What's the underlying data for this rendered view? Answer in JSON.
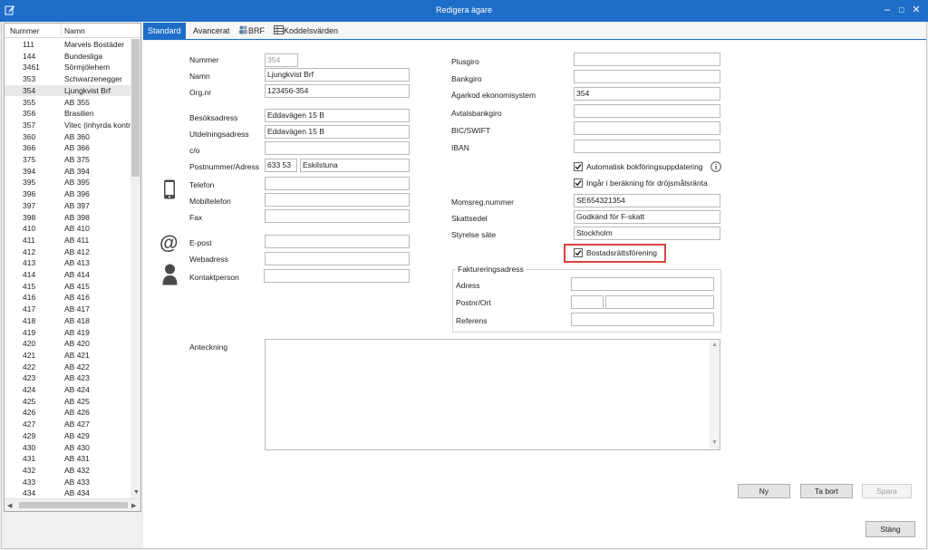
{
  "window": {
    "title": "Redigera ägare"
  },
  "list": {
    "headers": [
      "Nummer",
      "Namn"
    ],
    "rows": [
      {
        "num": "111",
        "name": "Marvels Bostäder"
      },
      {
        "num": "144",
        "name": "Bundesliga"
      },
      {
        "num": "3461",
        "name": "Sörmjölehem"
      },
      {
        "num": "353",
        "name": "Schwarzenegger"
      },
      {
        "num": "354",
        "name": "Ljungkvist Brf"
      },
      {
        "num": "355",
        "name": "AB 355"
      },
      {
        "num": "356",
        "name": "Brasilien"
      },
      {
        "num": "357",
        "name": "Vitec (inhyrda kontra"
      },
      {
        "num": "360",
        "name": "AB 360"
      },
      {
        "num": "366",
        "name": "AB 366"
      },
      {
        "num": "375",
        "name": "AB 375"
      },
      {
        "num": "394",
        "name": "AB 394"
      },
      {
        "num": "395",
        "name": "AB 395"
      },
      {
        "num": "396",
        "name": "AB 396"
      },
      {
        "num": "397",
        "name": "AB 397"
      },
      {
        "num": "398",
        "name": "AB 398"
      },
      {
        "num": "410",
        "name": "AB 410"
      },
      {
        "num": "411",
        "name": "AB 411"
      },
      {
        "num": "412",
        "name": "AB 412"
      },
      {
        "num": "413",
        "name": "AB 413"
      },
      {
        "num": "414",
        "name": "AB 414"
      },
      {
        "num": "415",
        "name": "AB 415"
      },
      {
        "num": "416",
        "name": "AB 416"
      },
      {
        "num": "417",
        "name": "AB 417"
      },
      {
        "num": "418",
        "name": "AB 418"
      },
      {
        "num": "419",
        "name": "AB 419"
      },
      {
        "num": "420",
        "name": "AB 420"
      },
      {
        "num": "421",
        "name": "AB 421"
      },
      {
        "num": "422",
        "name": "AB 422"
      },
      {
        "num": "423",
        "name": "AB 423"
      },
      {
        "num": "424",
        "name": "AB 424"
      },
      {
        "num": "425",
        "name": "AB 425"
      },
      {
        "num": "426",
        "name": "AB 426"
      },
      {
        "num": "427",
        "name": "AB 427"
      },
      {
        "num": "429",
        "name": "AB 429"
      },
      {
        "num": "430",
        "name": "AB 430"
      },
      {
        "num": "431",
        "name": "AB 431"
      },
      {
        "num": "432",
        "name": "AB 432"
      },
      {
        "num": "433",
        "name": "AB 433"
      },
      {
        "num": "434",
        "name": "AB 434"
      }
    ],
    "selected_index": 4
  },
  "tabs": [
    "Standard",
    "Avancerat",
    "BRF",
    "Koddelsvärden"
  ],
  "form": {
    "nummer": {
      "label": "Nummer",
      "value": "354"
    },
    "namn": {
      "label": "Namn",
      "value": "Ljungkvist Brf"
    },
    "orgnr": {
      "label": "Org.nr",
      "value": "123456-354"
    },
    "besoksadress": {
      "label": "Besöksadress",
      "value": "Eddavägen 15 B"
    },
    "utdelningsadress": {
      "label": "Utdelningsadress",
      "value": "Eddavägen 15 B"
    },
    "co": {
      "label": "c/o",
      "value": ""
    },
    "postnummer": {
      "label": "Postnummer/Adress",
      "zip": "633 53",
      "city": "Eskilstuna"
    },
    "telefon": {
      "label": "Telefon",
      "value": ""
    },
    "mobiltelefon": {
      "label": "Mobiltelefon",
      "value": ""
    },
    "fax": {
      "label": "Fax",
      "value": ""
    },
    "epost": {
      "label": "E-post",
      "value": ""
    },
    "webadress": {
      "label": "Webadress",
      "value": ""
    },
    "kontaktperson": {
      "label": "Kontaktperson",
      "value": ""
    },
    "plusgiro": {
      "label": "Plusgiro",
      "value": ""
    },
    "bankgiro": {
      "label": "Bankgiro",
      "value": ""
    },
    "agarkod": {
      "label": "Ägarkod ekonomisystem",
      "value": "354"
    },
    "avtalsbankgiro": {
      "label": "Avtalsbankgiro",
      "value": ""
    },
    "bic": {
      "label": "BIC/SWIFT",
      "value": ""
    },
    "iban": {
      "label": "IBAN",
      "value": ""
    },
    "chk_auto": {
      "label": "Automatisk bokföringsuppdatering",
      "checked": true
    },
    "chk_drojsmal": {
      "label": "Ingår i beräkning för dröjsmålsränta",
      "checked": true
    },
    "momsreg": {
      "label": "Momsreg.nummer",
      "value": "SE654321354"
    },
    "skattsedel": {
      "label": "Skattsedel",
      "value": "Godkänd för F-skatt"
    },
    "styrelse": {
      "label": "Styrelse säte",
      "value": "Stockholm"
    },
    "chk_brf": {
      "label": "Bostadsrättsförening",
      "checked": true
    },
    "faktura": {
      "title": "Faktureringsadress",
      "adress": {
        "label": "Adress",
        "value": ""
      },
      "postnr": {
        "label": "Postnr/Ort",
        "zip": "",
        "city": ""
      },
      "referens": {
        "label": "Referens",
        "value": ""
      }
    },
    "anteckning": {
      "label": "Anteckning",
      "value": ""
    }
  },
  "buttons": {
    "ny": "Ny",
    "tabort": "Ta bort",
    "spara": "Spara",
    "stang": "Stäng"
  },
  "colors": {
    "titlebar": "#1e6ec8",
    "highlight": "#d9433c"
  }
}
